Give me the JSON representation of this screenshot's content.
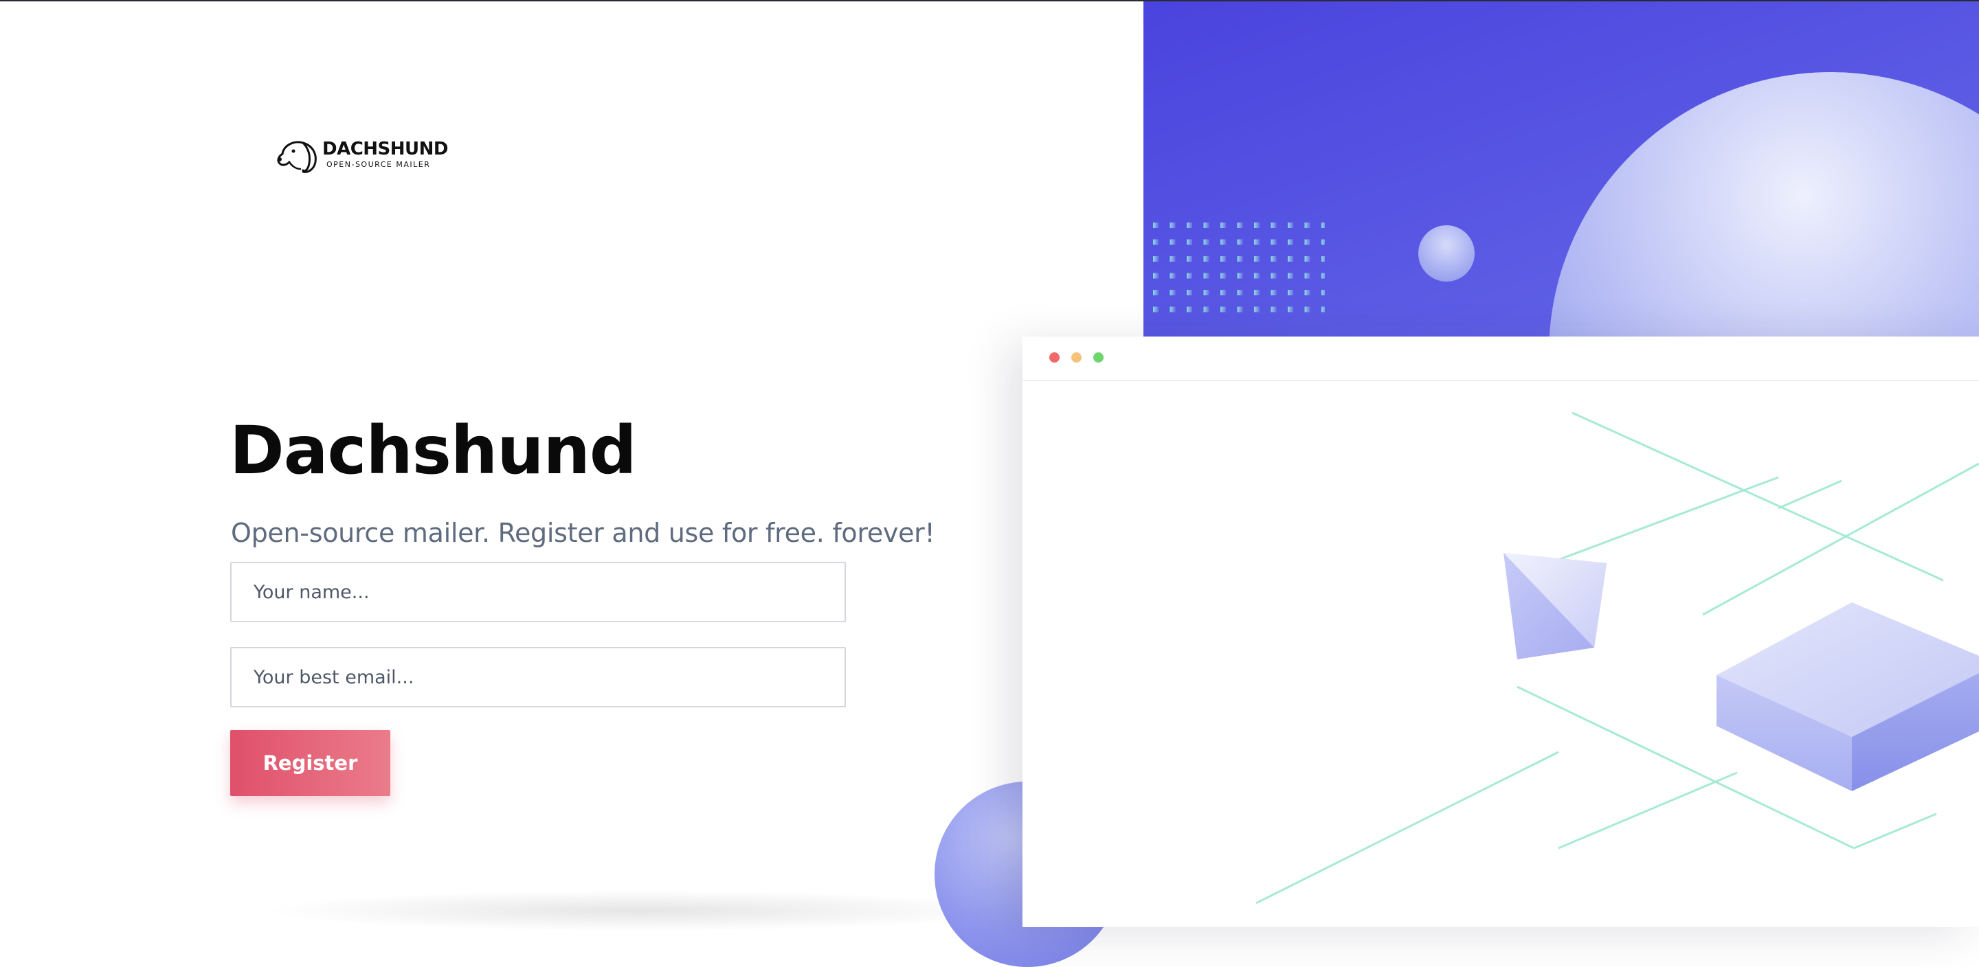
{
  "logo": {
    "name": "DACHSHUND",
    "tagline": "OPEN-SOURCE MAILER",
    "icon": "dachshund-dog-icon"
  },
  "hero": {
    "title": "Dachshund",
    "subtitle": "Open-source mailer. Register and use for free. forever!"
  },
  "form": {
    "name_placeholder": "Your name...",
    "email_placeholder": "Your best email...",
    "register_label": "Register"
  },
  "colors": {
    "accent": "#e0506a",
    "panel": "#4f4ade",
    "text_muted": "#5f6b7e"
  }
}
